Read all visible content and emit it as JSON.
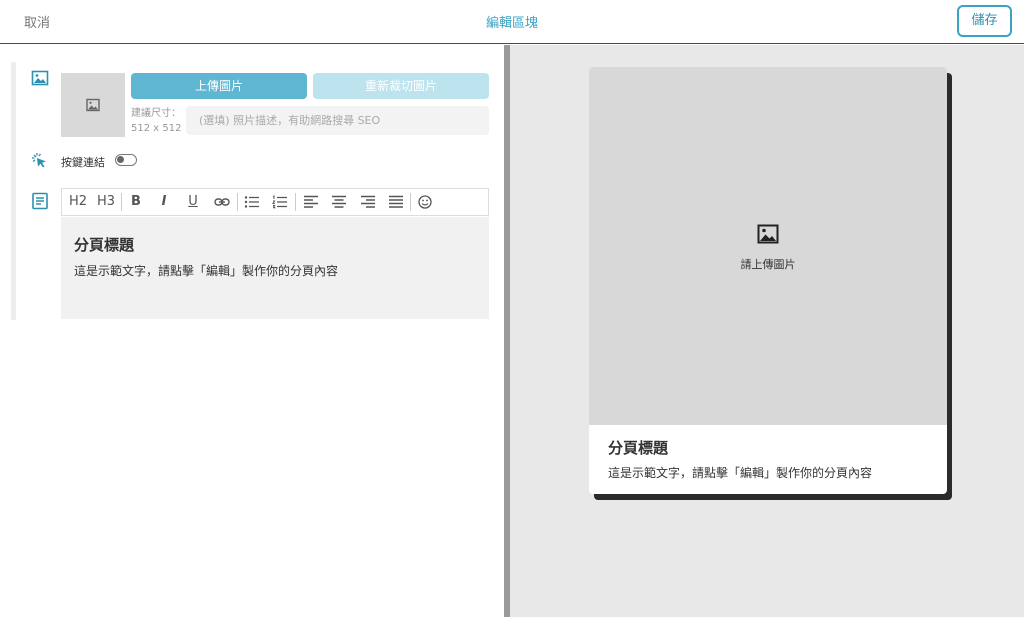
{
  "header": {
    "cancel_label": "取消",
    "title": "編輯區塊",
    "save_label": "儲存"
  },
  "image_section": {
    "upload_label": "上傳圖片",
    "recrop_label": "重新裁切圖片",
    "size_hint_label": "建議尺寸：",
    "size_hint_value": "512 x 512",
    "alt_placeholder": "(選填) 照片描述，有助網路搜尋 SEO"
  },
  "link_section": {
    "label": "按鍵連結",
    "enabled": false
  },
  "toolbar": {
    "h2": "H2",
    "h3": "H3",
    "bold": "B",
    "italic": "I",
    "underline": "U"
  },
  "content": {
    "heading": "分頁標題",
    "body": "這是示範文字，請點擊「編輯」製作你的分頁內容"
  },
  "preview": {
    "upload_hint": "請上傳圖片",
    "heading": "分頁標題",
    "body": "這是示範文字，請點擊「編輯」製作你的分頁內容"
  },
  "colors": {
    "accent": "#3aa3c4",
    "button_primary": "#5fb6d2",
    "button_disabled": "#bde3ee"
  }
}
